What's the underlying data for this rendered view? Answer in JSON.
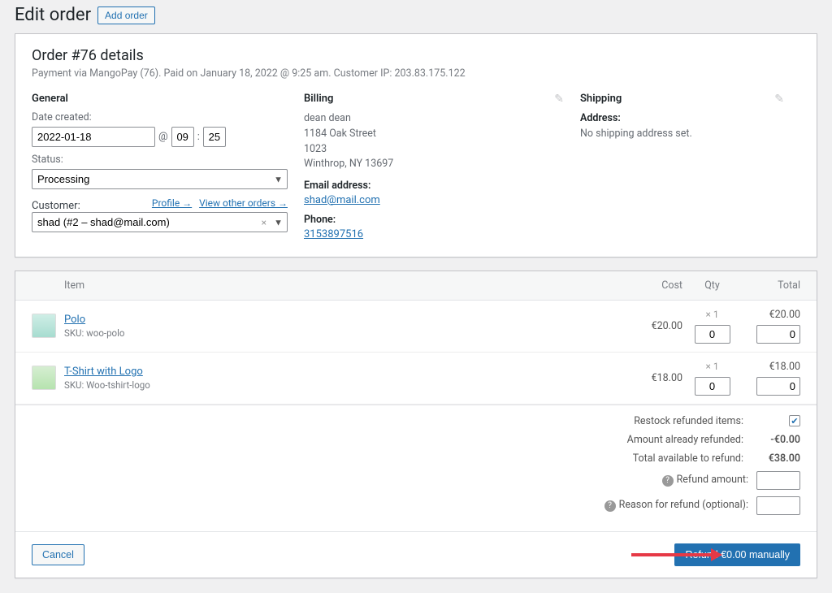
{
  "page": {
    "title": "Edit order",
    "add_order": "Add order"
  },
  "order": {
    "title": "Order #76 details",
    "meta": "Payment via MangoPay (76). Paid on January 18, 2022 @ 9:25 am. Customer IP: 203.83.175.122"
  },
  "general": {
    "heading": "General",
    "date_label": "Date created:",
    "date": "2022-01-18",
    "hour": "09",
    "min": "25",
    "status_label": "Status:",
    "status": "Processing",
    "customer_label": "Customer:",
    "customer": "shad (#2 – shad@mail.com)",
    "profile_link": "Profile →",
    "other_orders_link": "View other orders →"
  },
  "billing": {
    "heading": "Billing",
    "name": "dean dean",
    "street": "1184 Oak Street",
    "apt": "1023",
    "city": "Winthrop, NY 13697",
    "email_label": "Email address:",
    "email": "shad@mail.com",
    "phone_label": "Phone:",
    "phone": "3153897516"
  },
  "shipping": {
    "heading": "Shipping",
    "addr_label": "Address:",
    "none": "No shipping address set."
  },
  "items": {
    "item_label": "Item",
    "cost_label": "Cost",
    "qty_label": "Qty",
    "total_label": "Total",
    "rows": [
      {
        "name": "Polo",
        "sku": "SKU: woo-polo",
        "cost": "€20.00",
        "qty": "× 1",
        "total": "€20.00",
        "refund_qty": "0",
        "refund_total": "0"
      },
      {
        "name": "T-Shirt with Logo",
        "sku": "SKU: Woo-tshirt-logo",
        "cost": "€18.00",
        "qty": "× 1",
        "total": "€18.00",
        "refund_qty": "0",
        "refund_total": "0"
      }
    ]
  },
  "refund_summary": {
    "restock_label": "Restock refunded items:",
    "restock_checked": "true",
    "already_label": "Amount already refunded:",
    "already_value": "-€0.00",
    "avail_label": "Total available to refund:",
    "avail_value": "€38.00",
    "amount_label": "Refund amount:",
    "amount_value": "",
    "reason_label": "Reason for refund (optional):",
    "reason_value": ""
  },
  "footer": {
    "cancel": "Cancel",
    "button": "Refund €0.00 manually"
  }
}
